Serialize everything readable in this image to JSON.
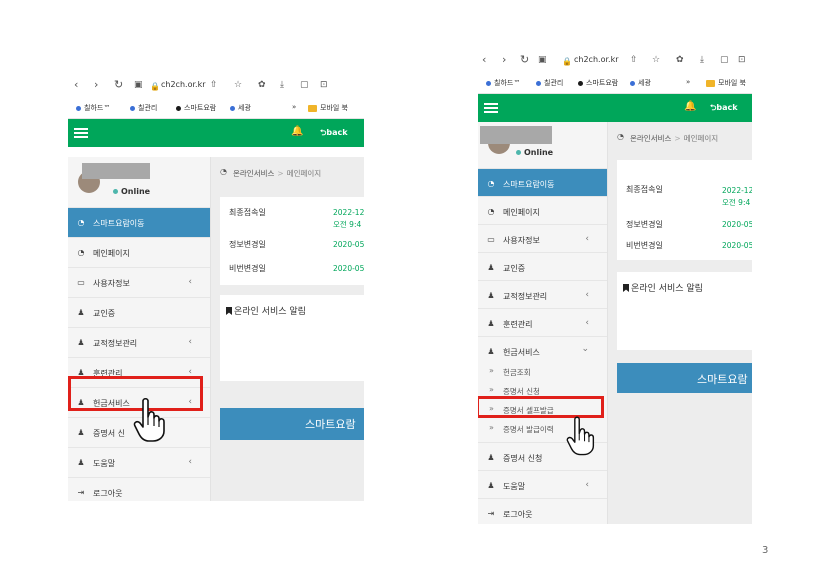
{
  "browser": {
    "url": "ch2ch.or.kr",
    "bookmarks": [
      {
        "label": "칠하드™",
        "color": "#3b6fd6"
      },
      {
        "label": "칠관리",
        "color": "#3b6fd6"
      },
      {
        "label": "스마트요람",
        "color": "#1a1a1a"
      },
      {
        "label": "세광",
        "color": "#3b6fd6"
      }
    ],
    "more": "»",
    "folder_label": "모바일 북"
  },
  "app": {
    "bell_icon": "bell-icon",
    "back_label": "back",
    "status_text": "Online"
  },
  "breadcrumb": {
    "root": "온라인서비스",
    "separator": ">",
    "current": "메인페이지"
  },
  "menu": {
    "smart_move": "스마트요람이동",
    "main_page": "메인페이지",
    "user_info": "사용자정보",
    "id_card": "교인증",
    "church_info": "교적정보관리",
    "training": "훈련관리",
    "cash_service": "헌금서비스",
    "cert_partial": "증명서 신",
    "cert_request": "증명서 신청",
    "help": "도움말",
    "logout": "로그아웃"
  },
  "submenu": {
    "cash_inquiry": "헌금조회",
    "cert_request": "증명서 신청",
    "cert_self_issue": "증명서 셀프발급",
    "cert_history_partial": "증명서 발급이력"
  },
  "info": {
    "last_login_label": "최종접속일",
    "last_login_date": "2022-12",
    "last_login_time": "오전 9:4",
    "last_login_time_right": "오전 9:4",
    "info_change_label": "정보변경일",
    "info_change_value": "2020-05",
    "pw_change_label": "비번변경일",
    "pw_change_value": "2020-05"
  },
  "notice": {
    "title": "온라인 서비스 알림"
  },
  "smart_button": {
    "left": "스마트요람",
    "right": "스마트요람"
  },
  "page_number": "3",
  "colors": {
    "topbar": "#00a65a",
    "active_menu": "#3c8dbc",
    "highlight_box": "#e0201a",
    "value_text": "#00a65a"
  }
}
